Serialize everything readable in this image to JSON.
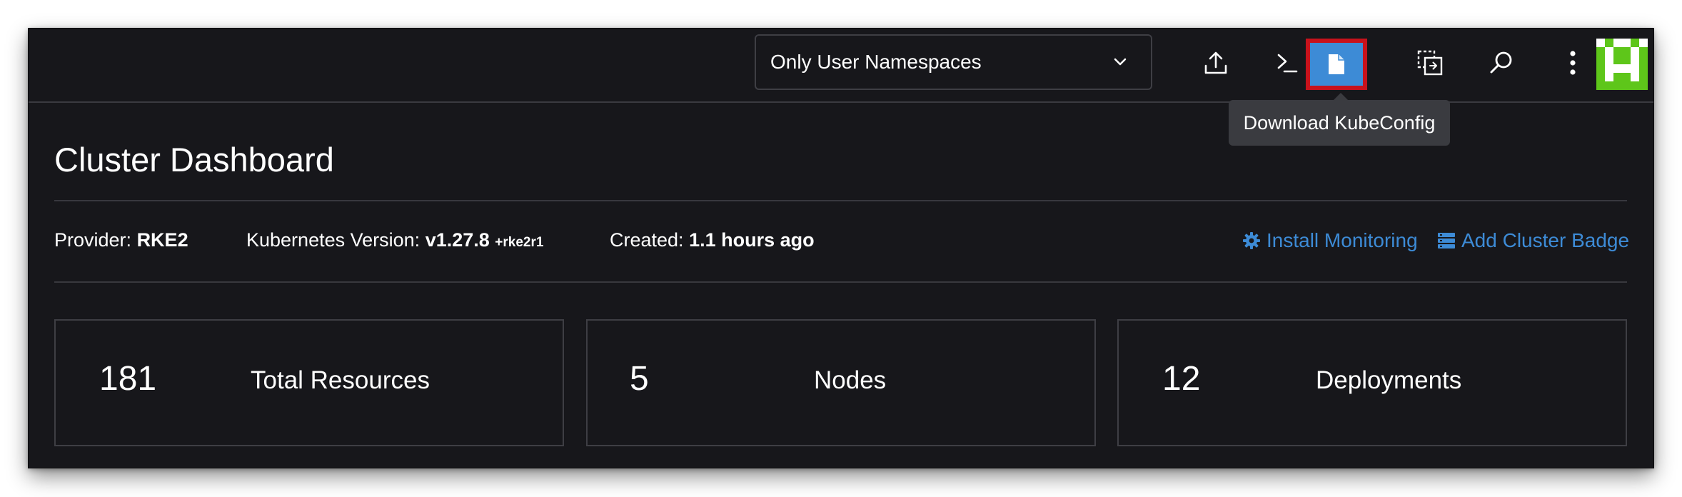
{
  "header": {
    "namespace_filter": {
      "selected": "Only User Namespaces"
    },
    "icons": [
      "import-yaml-icon",
      "kubectl-shell-icon",
      "download-kubeconfig-icon",
      "copy-kubeconfig-icon",
      "search-icon",
      "more-vert-icon"
    ],
    "tooltip": "Download KubeConfig",
    "colors": {
      "background": "#17171b",
      "accent": "#3d8bd6",
      "highlight": "#c8121c",
      "avatar": "#5ec61a"
    }
  },
  "dashboard": {
    "title": "Cluster Dashboard",
    "meta": {
      "provider_label": "Provider:",
      "provider_value": "RKE2",
      "version_label": "Kubernetes Version:",
      "version_value": "v1.27.8",
      "version_suffix": "+rke2r1",
      "created_label": "Created:",
      "created_value": "1.1 hours ago"
    },
    "actions": {
      "install_monitoring": "Install Monitoring",
      "add_cluster_badge": "Add Cluster Badge"
    },
    "cards": [
      {
        "value": "181",
        "label": "Total Resources"
      },
      {
        "value": "5",
        "label": "Nodes"
      },
      {
        "value": "12",
        "label": "Deployments"
      }
    ]
  }
}
